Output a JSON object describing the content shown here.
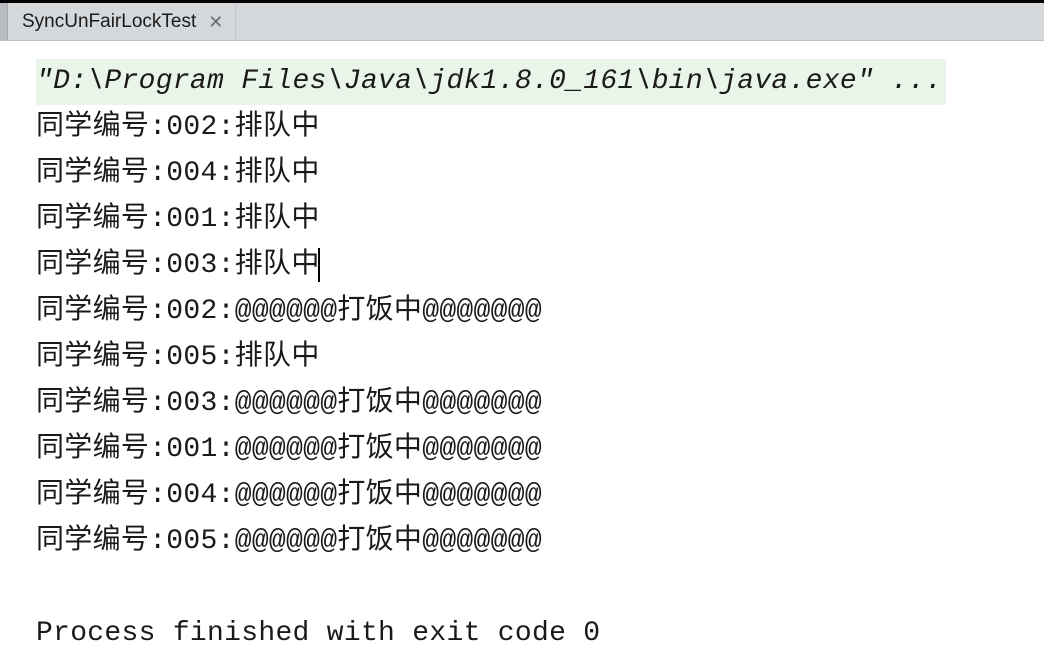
{
  "tab": {
    "title": "SyncUnFairLockTest"
  },
  "console": {
    "command": "\"D:\\Program Files\\Java\\jdk1.8.0_161\\bin\\java.exe\" ...",
    "lines": [
      {
        "text": "同学编号:002:排队中",
        "cursor": false
      },
      {
        "text": "同学编号:004:排队中",
        "cursor": false
      },
      {
        "text": "同学编号:001:排队中",
        "cursor": false
      },
      {
        "text": "同学编号:003:排队中",
        "cursor": true
      },
      {
        "text": "同学编号:002:@@@@@@打饭中@@@@@@@",
        "cursor": false
      },
      {
        "text": "同学编号:005:排队中",
        "cursor": false
      },
      {
        "text": "同学编号:003:@@@@@@打饭中@@@@@@@",
        "cursor": false
      },
      {
        "text": "同学编号:001:@@@@@@打饭中@@@@@@@",
        "cursor": false
      },
      {
        "text": "同学编号:004:@@@@@@打饭中@@@@@@@",
        "cursor": false
      },
      {
        "text": "同学编号:005:@@@@@@打饭中@@@@@@@",
        "cursor": false
      }
    ],
    "exit": "Process finished with exit code 0"
  }
}
